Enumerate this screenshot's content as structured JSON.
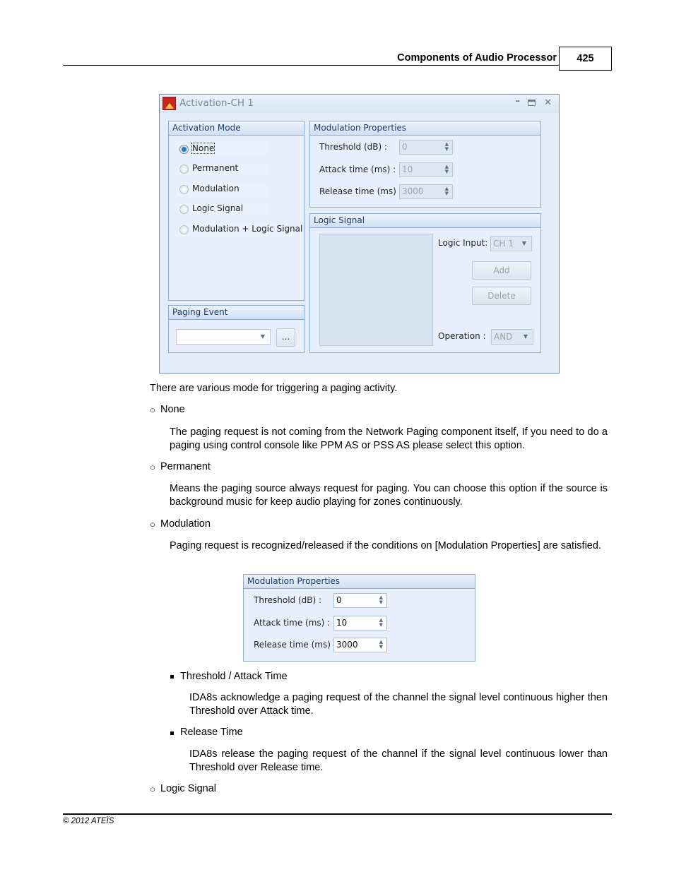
{
  "page_header": {
    "title": "Components of Audio Processor",
    "page_number": "425"
  },
  "dialog": {
    "title": "Activation-CH 1",
    "icon": "ateis-logo-icon",
    "controls": {
      "minimize": "–",
      "maximize": "maximize-icon",
      "close": "✕"
    },
    "activation_mode": {
      "header": "Activation Mode",
      "selected": "None",
      "options": [
        "None",
        "Permanent",
        "Modulation",
        "Logic Signal",
        "Modulation  + Logic Signal"
      ]
    },
    "modulation_properties": {
      "header": "Modulation Properties",
      "fields": [
        {
          "label": "Threshold (dB) :",
          "value": "0"
        },
        {
          "label": "Attack time (ms) :",
          "value": "10"
        },
        {
          "label": "Release time (ms) :",
          "value": "3000"
        }
      ]
    },
    "logic_signal": {
      "header": "Logic Signal",
      "logic_input_label": "Logic Input:",
      "logic_input_value": "CH 1",
      "add_label": "Add",
      "delete_label": "Delete",
      "operation_label": "Operation :",
      "operation_value": "AND"
    },
    "paging_event": {
      "header": "Paging Event",
      "value": "",
      "browse_label": "..."
    }
  },
  "body": {
    "intro": "There are various mode for triggering a paging activity.",
    "sections": [
      {
        "bullet": "○",
        "title": "None",
        "text": "The paging request is not coming from the Network Paging component itself, If you need to do a paging using control console like PPM AS or PSS AS please select this option."
      },
      {
        "bullet": "○",
        "title": "Permanent",
        "text": "Means the paging source always request for paging. You can choose this option if the source is background music for keep audio playing for zones continuously."
      },
      {
        "bullet": "○",
        "title": "Modulation",
        "text": "Paging request is recognized/released if the conditions on [Modulation Properties] are satisfied."
      }
    ],
    "modulation_panel": {
      "header": "Modulation Properties",
      "fields": [
        {
          "label": "Threshold (dB) :",
          "value": "0"
        },
        {
          "label": "Attack time (ms) :",
          "value": "10"
        },
        {
          "label": "Release time (ms) :",
          "value": "3000"
        }
      ]
    },
    "sub_items": [
      {
        "title": "Threshold / Attack Time",
        "text": "IDA8s acknowledge a paging request of the channel the signal level continuous higher then Threshold over Attack time."
      },
      {
        "title": "Release Time",
        "text": "IDA8s release the paging request of the channel if the signal level continuous lower than Threshold over Release time."
      }
    ],
    "last_section": {
      "bullet": "○",
      "title": "Logic Signal"
    }
  },
  "footer": {
    "copyright": "© 2012 ATEÏS"
  }
}
